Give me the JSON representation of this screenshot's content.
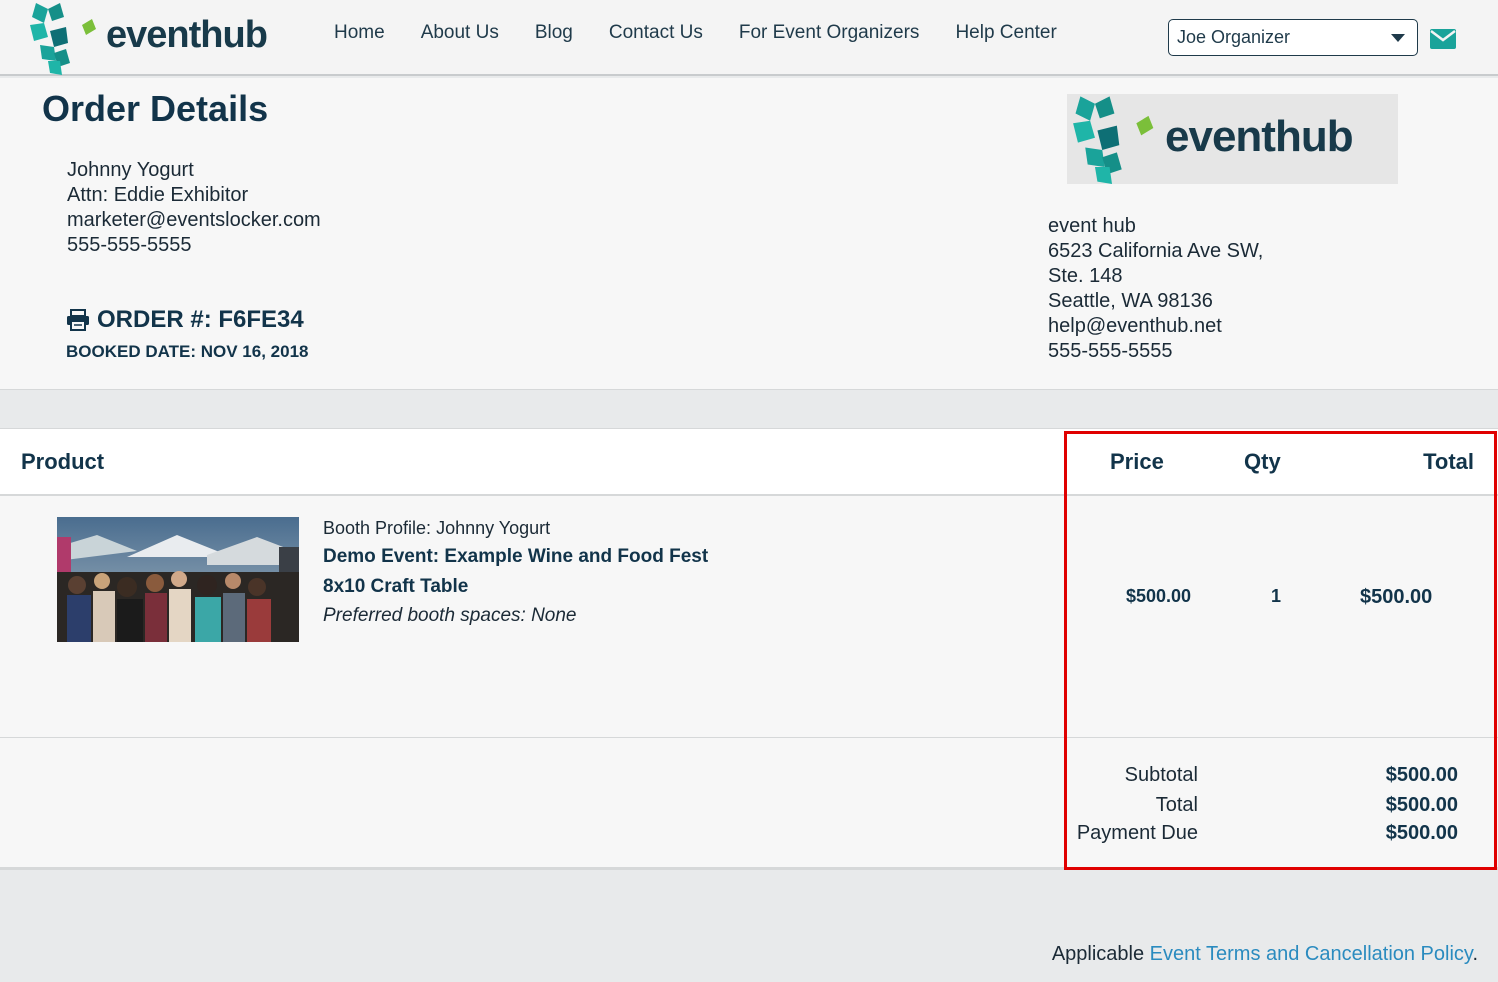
{
  "brand": {
    "name": "eventhub",
    "color_dark": "#183a4a",
    "color_teal": "#1aa39a",
    "color_green": "#7bbf3a"
  },
  "nav": {
    "items": [
      "Home",
      "About Us",
      "Blog",
      "Contact Us",
      "For Event Organizers",
      "Help Center"
    ]
  },
  "user_menu": {
    "selected": "Joe Organizer"
  },
  "order": {
    "title": "Order Details",
    "buyer": {
      "name": "Johnny Yogurt",
      "attn": "Attn: Eddie Exhibitor",
      "email": "marketer@eventslocker.com",
      "phone": "555-555-5555"
    },
    "order_number": "ORDER #: F6FE34",
    "booked_date": "BOOKED DATE: NOV 16, 2018",
    "seller": {
      "name": "event hub",
      "address1": "6523 California Ave SW,",
      "address2": "Ste. 148",
      "city": "Seattle, WA 98136",
      "email": "help@eventhub.net",
      "phone": "555-555-5555"
    }
  },
  "table": {
    "headers": {
      "product": "Product",
      "price": "Price",
      "qty": "Qty",
      "total": "Total"
    },
    "rows": [
      {
        "booth_profile": "Booth Profile: Johnny Yogurt",
        "event": "Demo Event: Example Wine and Food Fest",
        "item": "8x10 Craft Table",
        "preferred": "Preferred booth spaces: None",
        "price": "$500.00",
        "qty": "1",
        "total": "$500.00"
      }
    ],
    "summary": {
      "subtotal_label": "Subtotal",
      "subtotal": "$500.00",
      "total_label": "Total",
      "total": "$500.00",
      "due_label": "Payment Due",
      "due": "$500.00"
    }
  },
  "footer": {
    "prefix": "Applicable ",
    "link": "Event Terms and Cancellation Policy",
    "suffix": "."
  }
}
